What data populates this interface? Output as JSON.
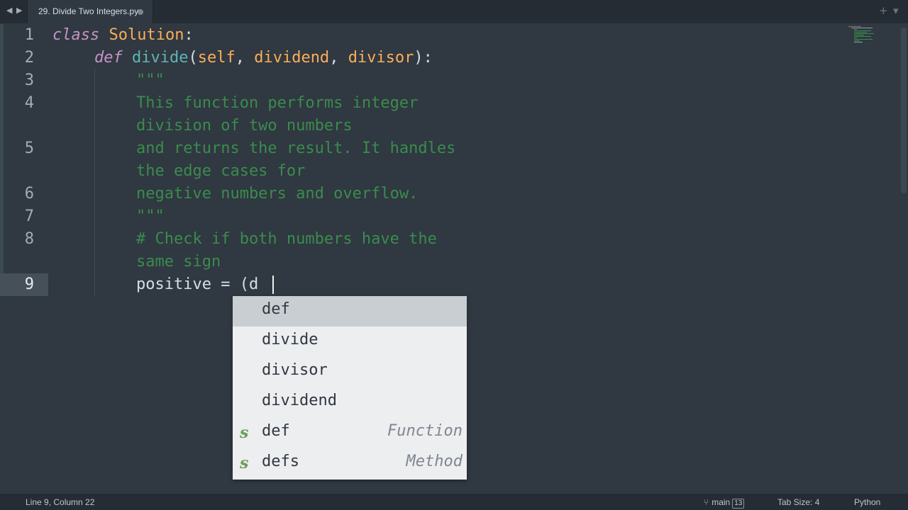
{
  "tabbar": {
    "back_icon": "◀",
    "forward_icon": "▶",
    "tab_title": "29. Divide Two Integers.py",
    "new_tab_icon": "+",
    "dropdown_icon": "▾"
  },
  "editor": {
    "line_numbers": [
      "1",
      "2",
      "3",
      "4",
      "5",
      "6",
      "7",
      "8",
      "9"
    ],
    "lines": {
      "l1": {
        "kw": "class",
        "name": "Solution",
        "punct": ":"
      },
      "l2": {
        "kw": "def",
        "fn": "divide",
        "open": "(",
        "p1": "self",
        "c1": ", ",
        "p2": "dividend",
        "c2": ", ",
        "p3": "divisor",
        "close": "):"
      },
      "l3": "\"\"\"",
      "l4a": "This function performs integer",
      "l4b": "division of two numbers",
      "l5a": "and returns the result. It handles",
      "l5b": "the edge cases for",
      "l6": "negative numbers and overflow.",
      "l7": "\"\"\"",
      "l8a": "# Check if both numbers have the",
      "l8b": "same sign",
      "l9": {
        "var": "positive",
        "op": " = ",
        "rest": "(d"
      }
    },
    "current_line": 9
  },
  "autocomplete": {
    "items": [
      {
        "kind": "",
        "label": "def",
        "hint": "",
        "selected": true
      },
      {
        "kind": "",
        "label": "divide",
        "hint": ""
      },
      {
        "kind": "",
        "label": "divisor",
        "hint": ""
      },
      {
        "kind": "",
        "label": "dividend",
        "hint": ""
      },
      {
        "kind": "s",
        "label": "def",
        "hint": "Function"
      },
      {
        "kind": "s",
        "label": "defs",
        "hint": "Method"
      }
    ]
  },
  "statusbar": {
    "position": "Line 9, Column 22",
    "branch": "main",
    "branch_count": "13",
    "tab_size": "Tab Size: 4",
    "syntax": "Python"
  },
  "colors": {
    "background": "#303841",
    "keyword": "#c594c5",
    "class_name": "#f9ae58",
    "function": "#5fb4b4",
    "comment": "#3a8c4d"
  }
}
